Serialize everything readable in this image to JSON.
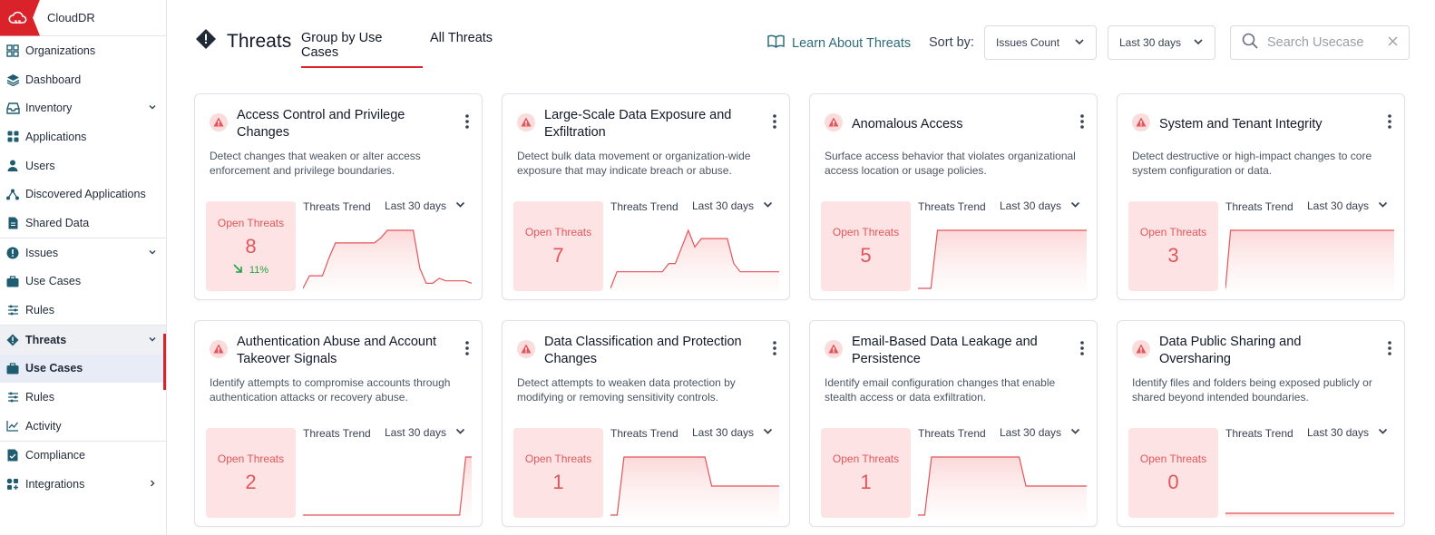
{
  "app": {
    "name": "CloudDR"
  },
  "sidebar": {
    "items": [
      {
        "label": "Organizations",
        "icon": "grid-icon"
      },
      {
        "label": "Dashboard",
        "icon": "layers-icon"
      },
      {
        "label": "Inventory",
        "icon": "inbox-icon",
        "expandable": true
      },
      {
        "label": "Applications",
        "icon": "apps-icon"
      },
      {
        "label": "Users",
        "icon": "user-icon"
      },
      {
        "label": "Discovered Applications",
        "icon": "nodes-icon"
      },
      {
        "label": "Shared Data",
        "icon": "file-icon"
      },
      {
        "label": "Issues",
        "icon": "alert-circle-icon",
        "expandable": true
      },
      {
        "label": "Use Cases",
        "icon": "briefcase-icon"
      },
      {
        "label": "Rules",
        "icon": "sliders-icon"
      },
      {
        "label": "Threats",
        "icon": "alert-diamond-icon",
        "expandable": true
      },
      {
        "label": "Use Cases",
        "icon": "briefcase-icon"
      },
      {
        "label": "Rules",
        "icon": "sliders-icon"
      },
      {
        "label": "Activity",
        "icon": "chart-line-icon"
      },
      {
        "label": "Compliance",
        "icon": "file-check-icon"
      },
      {
        "label": "Integrations",
        "icon": "integrations-icon"
      }
    ]
  },
  "header": {
    "title": "Threats",
    "tabs": [
      {
        "label": "Group by Use Cases"
      },
      {
        "label": "All Threats"
      }
    ],
    "learn_link": "Learn About Threats",
    "sort_label": "Sort by:",
    "sort_value": "Issues Count",
    "range_value": "Last 30 days",
    "search_placeholder": "Search Usecase"
  },
  "colors": {
    "accent": "#d9222a",
    "threat": "#e2555b",
    "open_bg": "#fde3e3",
    "trend_down": "#20a544",
    "link": "#2e6b7a"
  },
  "card_common": {
    "open_label": "Open Threats",
    "trend_label": "Threats Trend",
    "range_label": "Last 30 days"
  },
  "cards": [
    {
      "title": "Access Control and Privilege Changes",
      "description": "Detect changes that weaken or alter access enforcement and privilege boundaries.",
      "open_count": "8",
      "delta": "11%",
      "trend": [
        0,
        5,
        5,
        5,
        12,
        18,
        18,
        18,
        18,
        18,
        18,
        18,
        20,
        23,
        23,
        23,
        23,
        23,
        8,
        2,
        2,
        4,
        3,
        3,
        3,
        3,
        2
      ]
    },
    {
      "title": "Large-Scale Data Exposure and Exfiltration",
      "description": "Detect bulk data movement or organization-wide exposure that may indicate breach or abuse.",
      "open_count": "7",
      "delta": "",
      "trend": [
        0,
        4,
        4,
        4,
        4,
        4,
        4,
        4,
        4,
        6,
        6,
        10,
        14,
        10,
        12,
        12,
        12,
        12,
        12,
        6,
        4,
        4,
        4,
        4,
        4,
        4,
        4
      ]
    },
    {
      "title": "Anomalous Access",
      "description": "Surface access behavior that violates organizational access location or usage policies.",
      "open_count": "5",
      "delta": "",
      "trend": [
        0,
        0,
        0,
        10,
        10,
        10,
        10,
        10,
        10,
        10,
        10,
        10,
        10,
        10,
        10,
        10,
        10,
        10,
        10,
        10,
        10,
        10,
        10,
        10,
        10,
        10,
        10
      ]
    },
    {
      "title": "System and Tenant Integrity",
      "description": "Detect destructive or high-impact changes to core system configuration or data.",
      "open_count": "3",
      "delta": "",
      "trend": [
        0,
        5,
        5,
        5,
        5,
        5,
        5,
        5,
        5,
        5,
        5,
        5,
        5,
        5,
        5,
        5,
        5,
        5,
        5,
        5,
        5,
        5,
        5,
        5,
        5,
        5,
        5,
        5,
        5,
        5,
        5,
        5,
        5,
        5
      ]
    },
    {
      "title": "Authentication Abuse and Account Takeover Signals",
      "description": "Identify attempts to compromise accounts through authentication attacks or recovery abuse.",
      "open_count": "2",
      "delta": "",
      "trend": [
        0,
        0,
        0,
        0,
        0,
        0,
        0,
        0,
        0,
        0,
        0,
        0,
        0,
        0,
        0,
        0,
        0,
        0,
        0,
        0,
        0,
        0,
        0,
        0,
        0,
        0,
        0,
        2,
        2
      ]
    },
    {
      "title": "Data Classification and Protection Changes",
      "description": "Detect attempts to weaken data protection by modifying or removing sensitivity controls.",
      "open_count": "1",
      "delta": "",
      "trend": [
        0,
        0,
        2,
        2,
        2,
        2,
        2,
        2,
        2,
        2,
        2,
        2,
        2,
        2,
        2,
        1,
        1,
        1,
        1,
        1,
        1,
        1,
        1,
        1,
        1,
        1
      ]
    },
    {
      "title": "Email-Based Data Leakage and Persistence",
      "description": "Identify email configuration changes that enable stealth access or data exfiltration.",
      "open_count": "1",
      "delta": "",
      "trend": [
        0,
        0,
        2,
        2,
        2,
        2,
        2,
        2,
        2,
        2,
        2,
        2,
        2,
        2,
        2,
        2,
        1,
        1,
        1,
        1,
        1,
        1,
        1,
        1,
        1,
        1
      ]
    },
    {
      "title": "Data Public Sharing and Oversharing",
      "description": "Identify files and folders being exposed publicly or shared beyond intended boundaries.",
      "open_count": "0",
      "delta": "",
      "trend": [
        0,
        0,
        0,
        0,
        0,
        0,
        0,
        0,
        0,
        0,
        0,
        0,
        0,
        0,
        0,
        0,
        0,
        0,
        0,
        0,
        0,
        0,
        0,
        0,
        0,
        0
      ]
    }
  ]
}
